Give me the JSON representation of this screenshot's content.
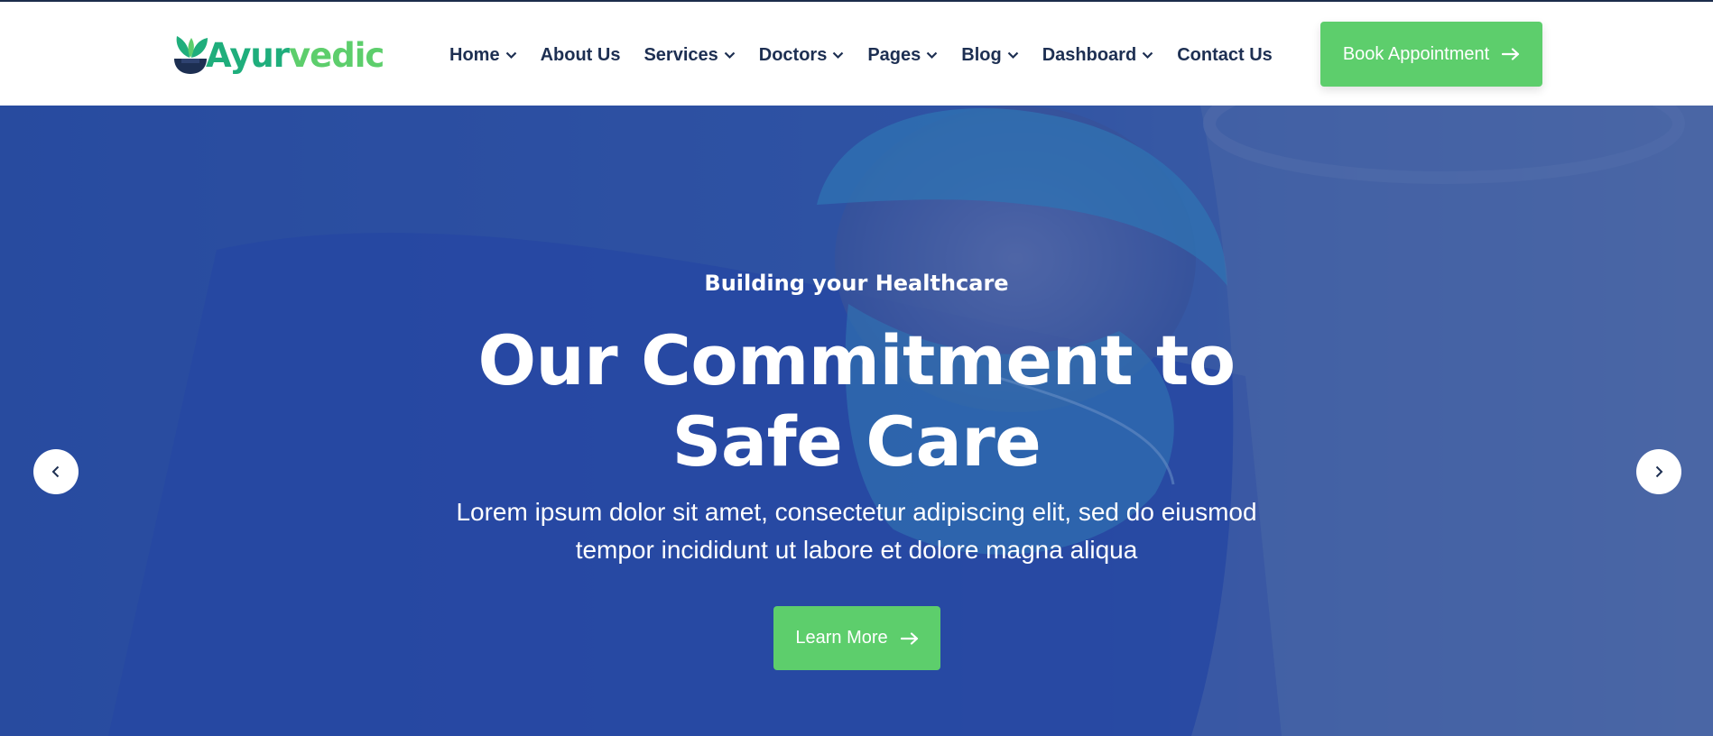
{
  "brand": {
    "name_part1": "Ayur",
    "name_part2": "vedic",
    "icon": "leaf-bowl-icon"
  },
  "nav": {
    "items": [
      {
        "label": "Home",
        "has_dropdown": true
      },
      {
        "label": "About Us",
        "has_dropdown": false
      },
      {
        "label": "Services",
        "has_dropdown": true
      },
      {
        "label": "Doctors",
        "has_dropdown": true
      },
      {
        "label": "Pages",
        "has_dropdown": true
      },
      {
        "label": "Blog",
        "has_dropdown": true
      },
      {
        "label": "Dashboard",
        "has_dropdown": true
      },
      {
        "label": "Contact Us",
        "has_dropdown": false
      }
    ]
  },
  "header": {
    "cta_label": "Book Appointment"
  },
  "hero": {
    "subtitle": "Building your Healthcare",
    "title_line1": "Our Commitment to",
    "title_line2": "Safe Care",
    "description_line1": "Lorem ipsum dolor sit amet, consectetur adipiscing elit, sed do eiusmod",
    "description_line2": "tempor incididunt ut labore et dolore magna aliqua",
    "cta_label": "Learn More",
    "prev_icon": "chevron-left-icon",
    "next_icon": "chevron-right-icon"
  },
  "colors": {
    "accent_green": "#5dce6c",
    "logo_teal": "#1fae7c",
    "nav_text": "#1d2f52",
    "hero_overlay": "#2648a0"
  }
}
